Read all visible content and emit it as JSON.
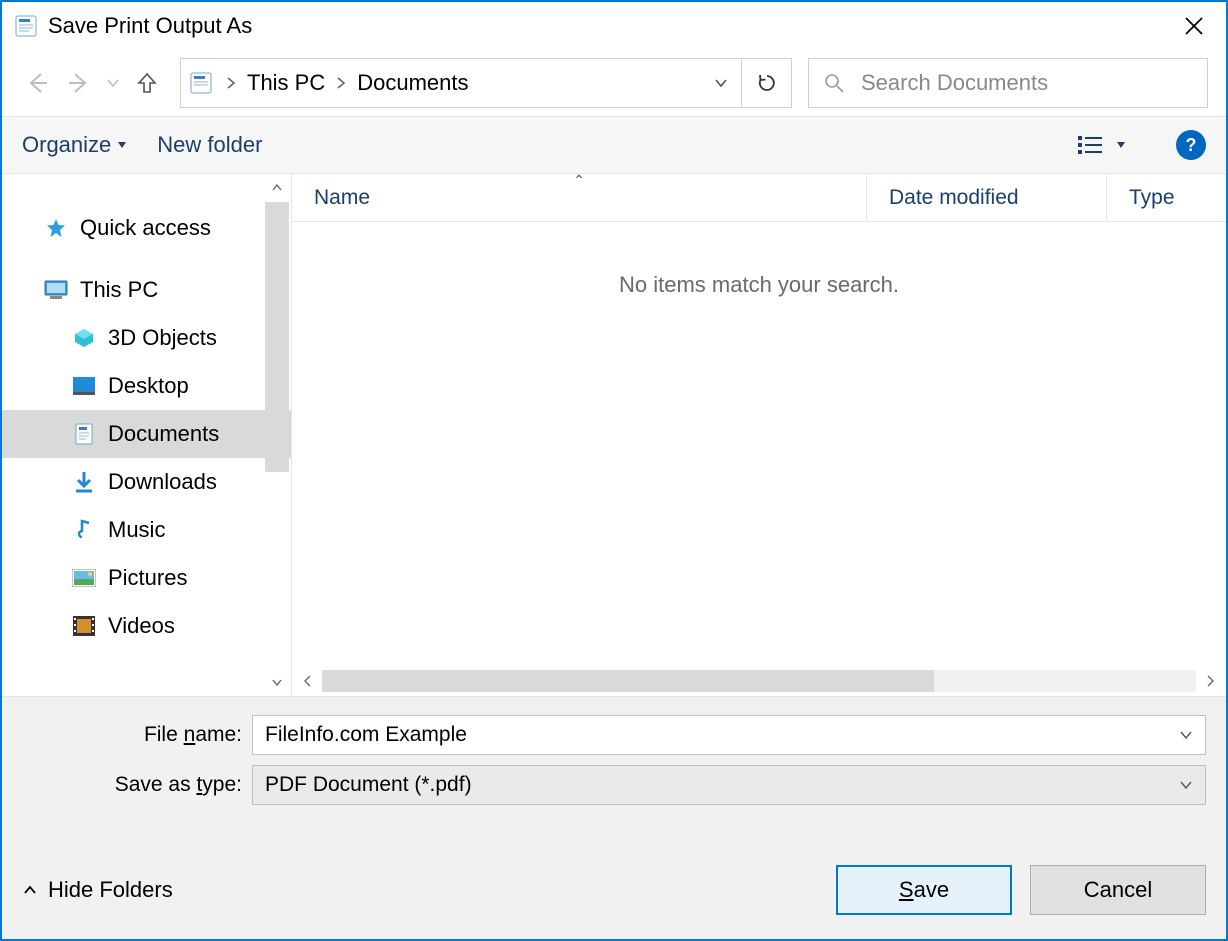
{
  "title": "Save Print Output As",
  "breadcrumb": {
    "root": "This PC",
    "current": "Documents"
  },
  "search": {
    "placeholder": "Search Documents"
  },
  "toolbar": {
    "organize": "Organize",
    "new_folder": "New folder"
  },
  "sidebar": {
    "quick_access": "Quick access",
    "this_pc": "This PC",
    "items": [
      {
        "label": "3D Objects"
      },
      {
        "label": "Desktop"
      },
      {
        "label": "Documents"
      },
      {
        "label": "Downloads"
      },
      {
        "label": "Music"
      },
      {
        "label": "Pictures"
      },
      {
        "label": "Videos"
      }
    ]
  },
  "columns": {
    "name": "Name",
    "date": "Date modified",
    "type": "Type"
  },
  "empty_message": "No items match your search.",
  "form": {
    "file_name_label_pre": "File ",
    "file_name_label_u": "n",
    "file_name_label_post": "ame:",
    "file_name_value": "FileInfo.com Example",
    "save_type_label_pre": "Save as ",
    "save_type_label_u": "t",
    "save_type_label_post": "ype:",
    "save_type_value": "PDF Document (*.pdf)"
  },
  "footer": {
    "hide_folders": "Hide Folders",
    "save_pre": "",
    "save_u": "S",
    "save_post": "ave",
    "cancel": "Cancel"
  }
}
